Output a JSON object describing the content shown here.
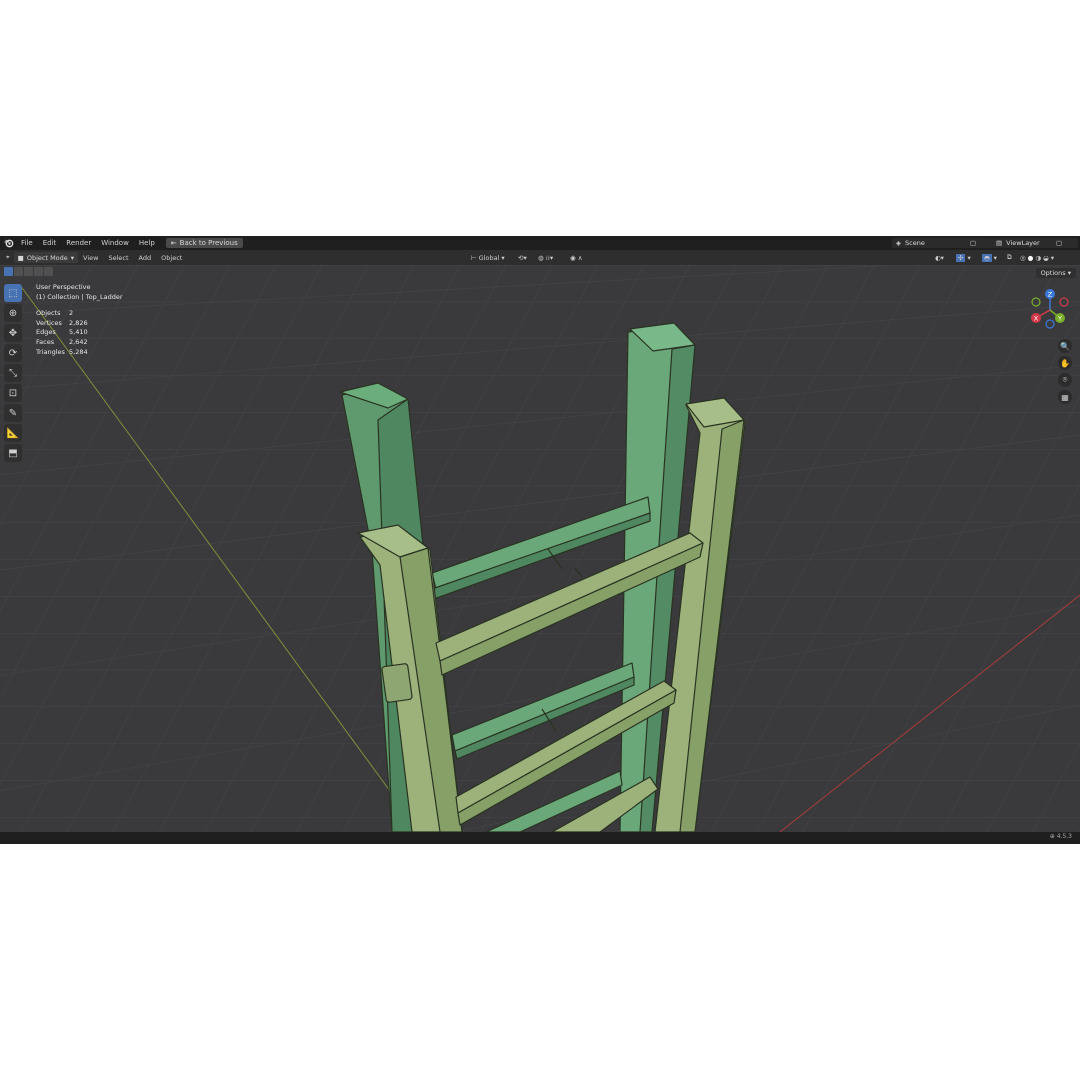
{
  "topbar": {
    "menus": [
      "File",
      "Edit",
      "Render",
      "Window",
      "Help"
    ],
    "back_button": "Back to Previous",
    "scene": "Scene",
    "view_layer": "ViewLayer"
  },
  "header": {
    "mode": "Object Mode",
    "menus": [
      "View",
      "Select",
      "Add",
      "Object"
    ],
    "orientation": "Global",
    "options": "Options"
  },
  "overlay": {
    "perspective": "User Perspective",
    "collection": "(1) Collection | Top_Ladder",
    "stats": [
      {
        "label": "Objects",
        "value": "2"
      },
      {
        "label": "Vertices",
        "value": "2,826"
      },
      {
        "label": "Edges",
        "value": "5,410"
      },
      {
        "label": "Faces",
        "value": "2,642"
      },
      {
        "label": "Triangles",
        "value": "5,284"
      }
    ]
  },
  "gizmo": {
    "z": "Z",
    "y": "Y",
    "x": "X"
  },
  "toolbar": [
    "select-box-icon",
    "cursor-icon",
    "move-icon",
    "rotate-icon",
    "scale-icon",
    "transform-icon",
    "annotate-icon",
    "measure-icon",
    "add-cube-icon"
  ],
  "status": {
    "version": "4.5.3"
  },
  "colors": {
    "accent": "#4772b3",
    "ladder_front": "#9cb27a",
    "ladder_back": "#6aa87a",
    "grid_bg": "#3a3a3d"
  }
}
